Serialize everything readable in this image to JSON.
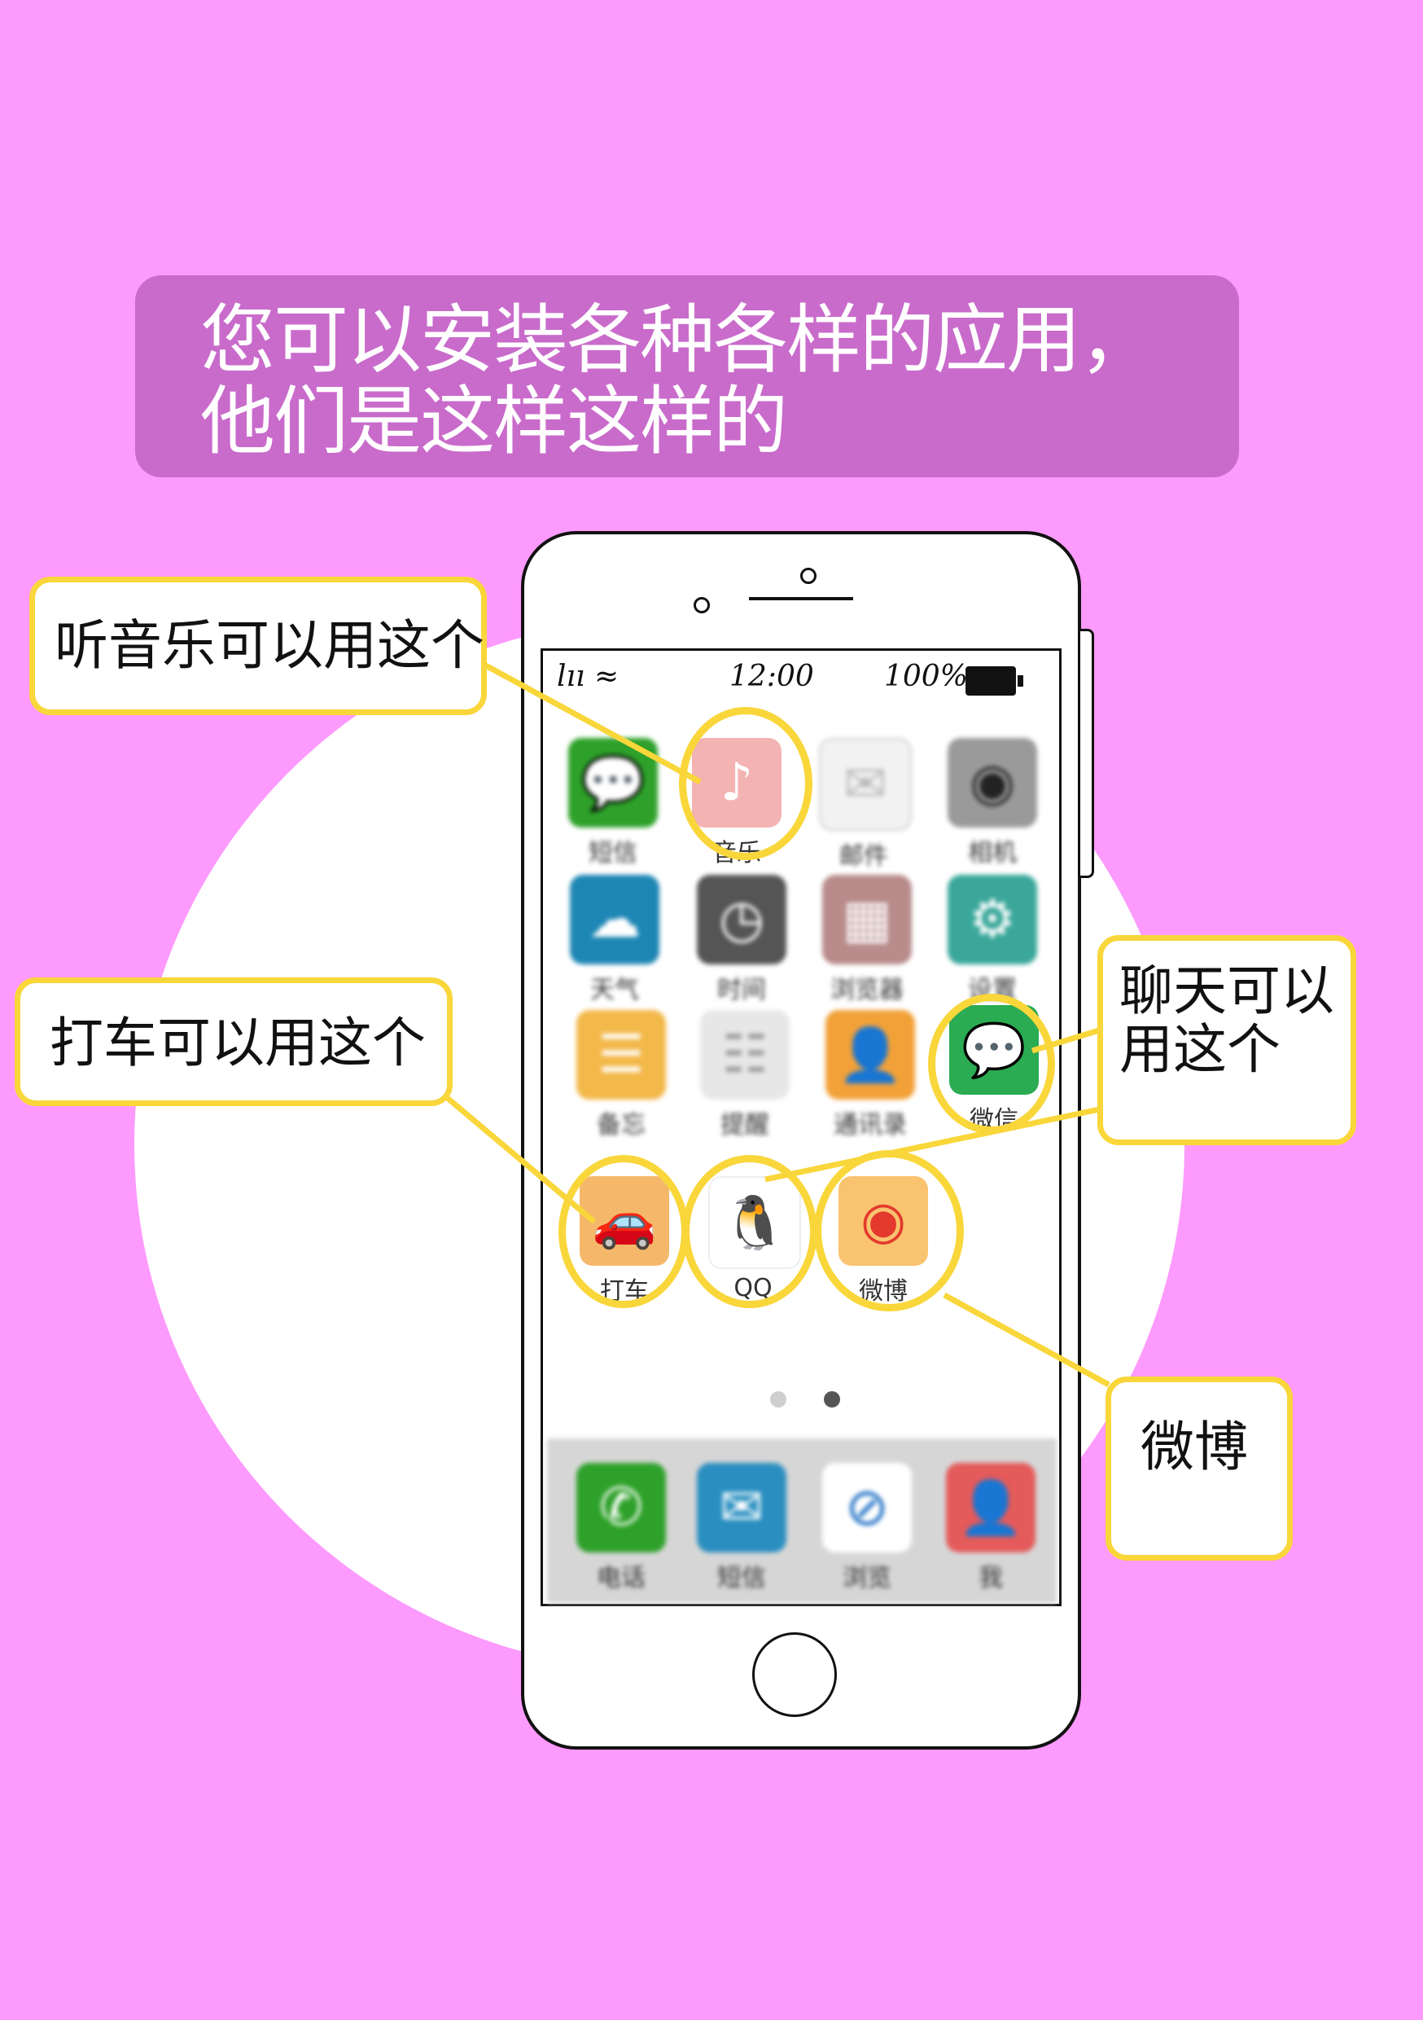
{
  "banner": {
    "line1": "您可以安装各种各样的应用，",
    "line2": "他们是这样这样的"
  },
  "status_bar": {
    "time": "12:00",
    "battery": "100%"
  },
  "apps": {
    "row1": [
      {
        "label": "短信",
        "icon": "message-bubble-icon",
        "color": "#2ea12a"
      },
      {
        "label": "音乐",
        "icon": "music-note-icon",
        "color": "#f4b3b3"
      },
      {
        "label": "邮件",
        "icon": "envelope-icon",
        "color": "#f2f2f2"
      },
      {
        "label": "相机",
        "icon": "camera-icon",
        "color": "#9a9a9a"
      }
    ],
    "row2": [
      {
        "label": "天气",
        "icon": "weather-icon",
        "color": "#1e86b4"
      },
      {
        "label": "时间",
        "icon": "clock-icon",
        "color": "#555555"
      },
      {
        "label": "浏览器",
        "icon": "map-icon",
        "color": "#b98b8b"
      },
      {
        "label": "设置",
        "icon": "gear-icon",
        "color": "#3aa79a"
      }
    ],
    "row3": [
      {
        "label": "备忘",
        "icon": "notes-icon",
        "color": "#f3b84a"
      },
      {
        "label": "提醒",
        "icon": "list-icon",
        "color": "#e7e7e7"
      },
      {
        "label": "通讯录",
        "icon": "contact-icon",
        "color": "#f2a138"
      },
      {
        "label": "微信",
        "icon": "wechat-icon",
        "color": "#2bab52"
      }
    ],
    "row4": [
      {
        "label": "打车",
        "icon": "car-icon",
        "color": "#f5b86b"
      },
      {
        "label": "QQ",
        "icon": "penguin-icon",
        "color": "#ffffff"
      },
      {
        "label": "微博",
        "icon": "weibo-icon",
        "color": "#f9c36f"
      }
    ]
  },
  "dock": [
    {
      "label": "电话",
      "icon": "phone-icon",
      "color": "#2ea12a"
    },
    {
      "label": "短信",
      "icon": "mail-icon",
      "color": "#2a8fc0"
    },
    {
      "label": "浏览",
      "icon": "compass-icon",
      "color": "#ffffff"
    },
    {
      "label": "我",
      "icon": "person-icon",
      "color": "#e55a5a"
    }
  ],
  "callouts": {
    "music": "听音乐可以用这个",
    "taxi": "打车可以用这个",
    "chat": "聊天可以用这个",
    "weibo": "微博"
  },
  "accent_color": "#f9d63a",
  "background_color": "#fd9afd"
}
